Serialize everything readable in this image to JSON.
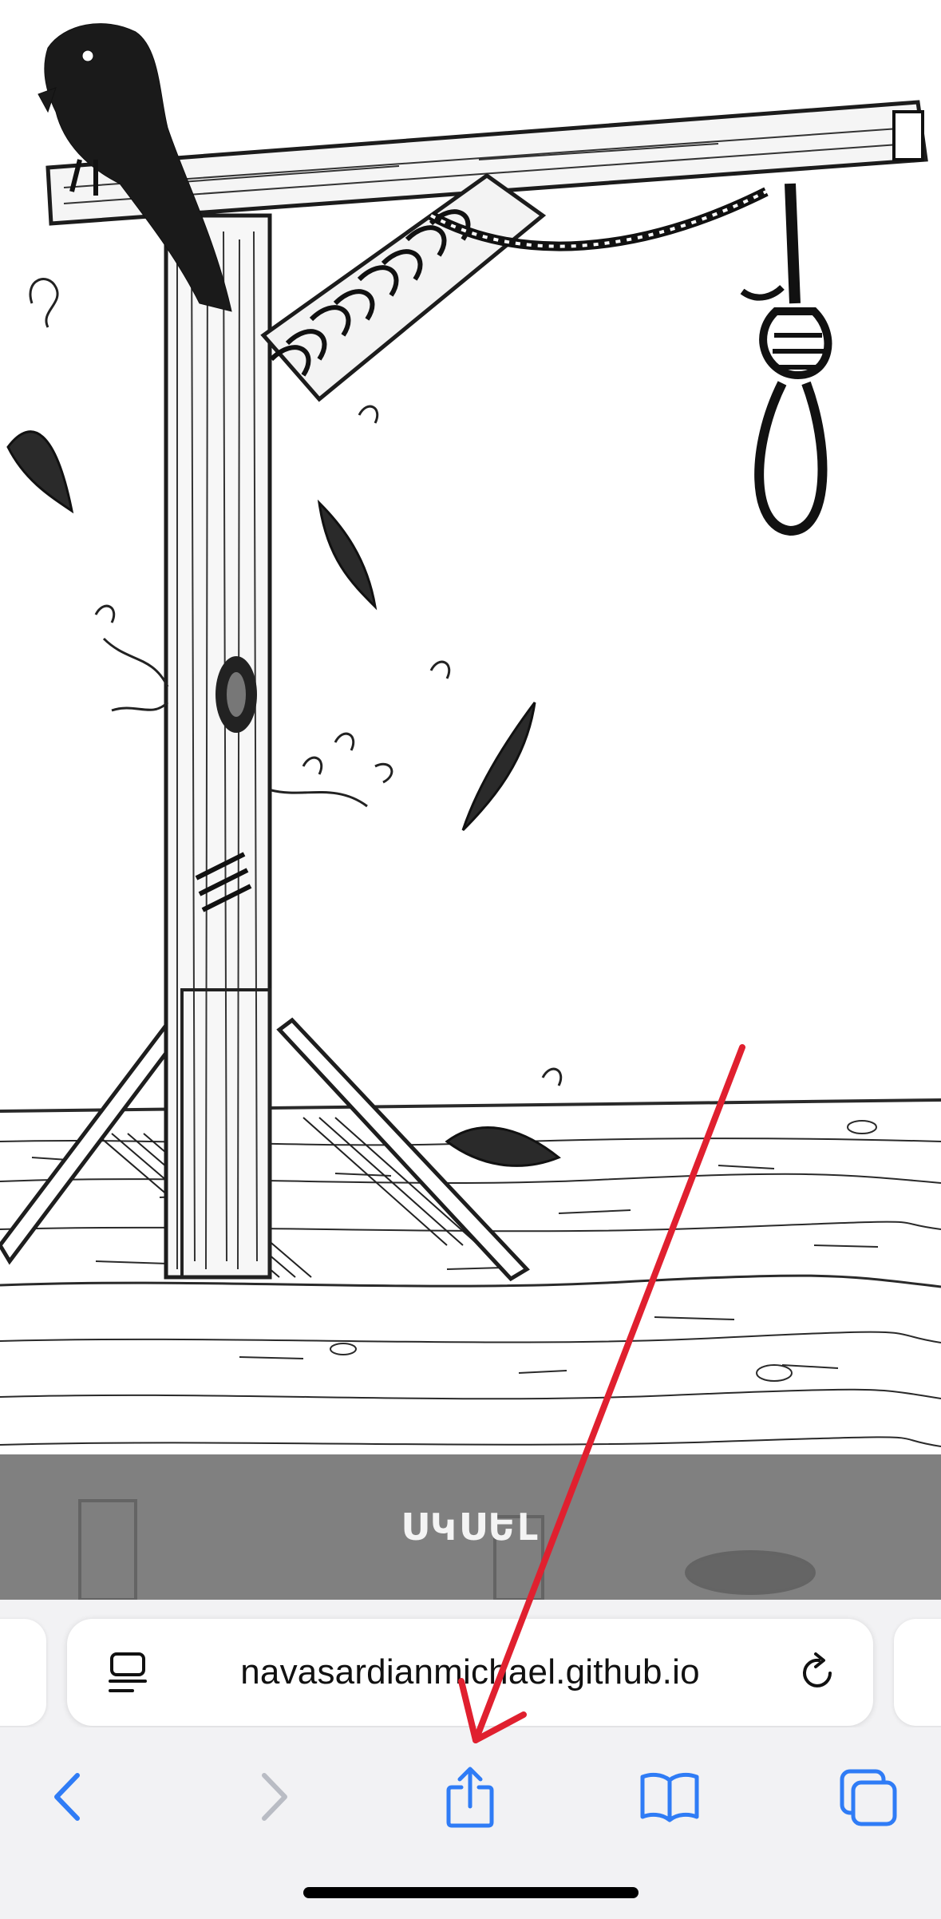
{
  "page": {
    "start_label": "ՍԿՍԵԼ",
    "illustration_alt": "gallows-drawing"
  },
  "browser": {
    "url": "navasardianmichael.github.io",
    "accent_color": "#2f7cf6",
    "disabled_color": "#b9bcc4"
  },
  "toolbar": {
    "back": "back-icon",
    "forward": "forward-icon",
    "share": "share-icon",
    "bookmarks": "bookmarks-icon",
    "tabs": "tabs-icon"
  },
  "annotation": {
    "arrow_color": "#e0202f",
    "points_to": "share-button"
  }
}
